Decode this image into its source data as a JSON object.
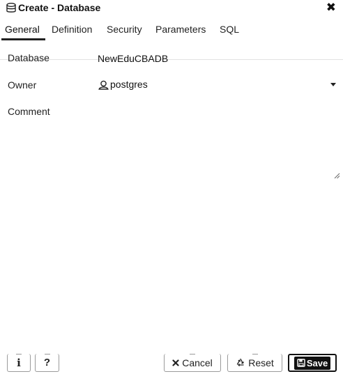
{
  "dialog": {
    "title": "Create - Database",
    "close_glyph": "✖",
    "title_icon": "database-icon"
  },
  "tabs": [
    {
      "label": "General",
      "active": true
    },
    {
      "label": "Definition",
      "active": false
    },
    {
      "label": "Security",
      "active": false
    },
    {
      "label": "Parameters",
      "active": false
    },
    {
      "label": "SQL",
      "active": false
    }
  ],
  "form": {
    "database_label": "Database",
    "database_value": "NewEduCBADB",
    "owner_label": "Owner",
    "owner_value": "postgres",
    "comment_label": "Comment",
    "comment_value": ""
  },
  "footer": {
    "info_glyph": "i",
    "help_glyph": "?",
    "cancel_label": "Cancel",
    "reset_label": "Reset",
    "save_label": "Save"
  },
  "colors": {
    "text": "#222222",
    "active_tab_underline": "#222222",
    "save_button_bg": "#111111"
  }
}
